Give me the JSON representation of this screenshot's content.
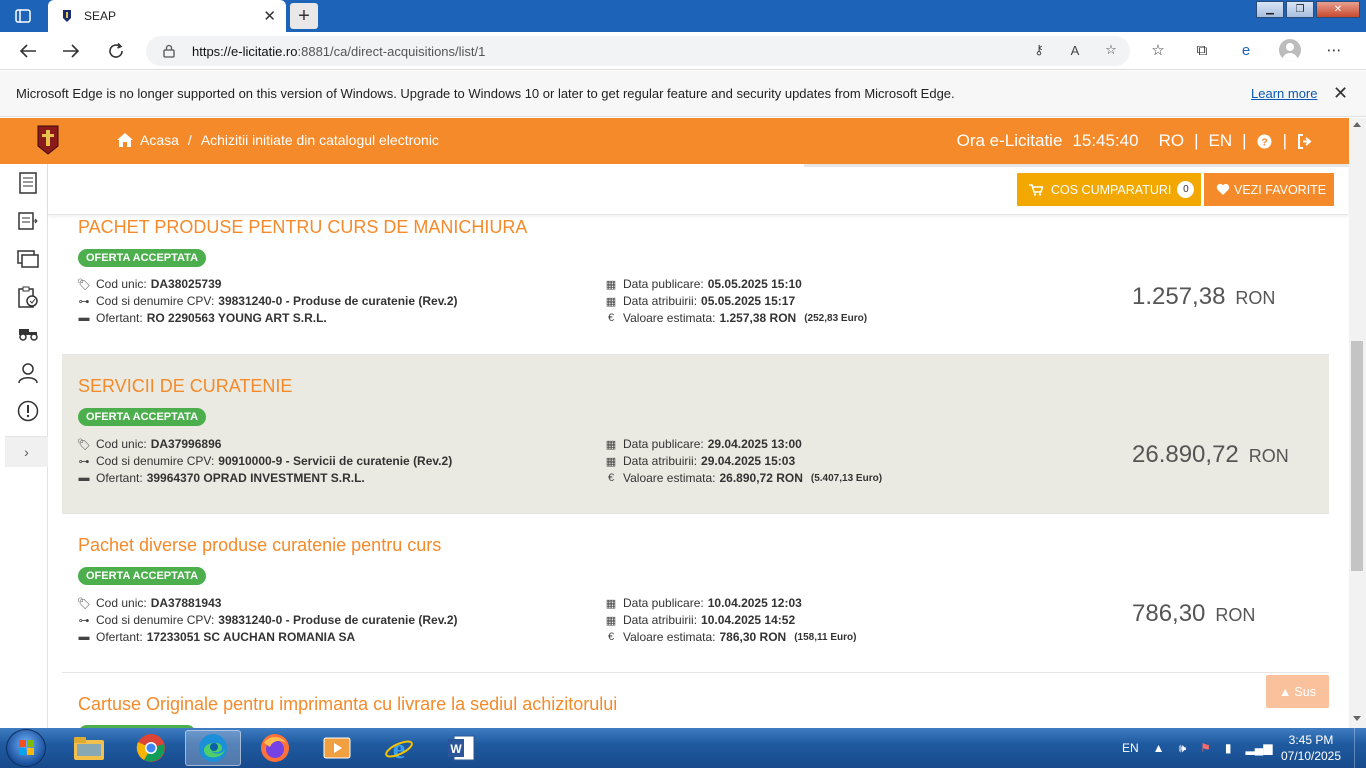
{
  "browser": {
    "tab_title": "SEAP",
    "url_domain": "https://e-licitatie.ro",
    "url_rest": ":8881/ca/direct-acquisitions/list/1",
    "infobar_text": "Microsoft Edge is no longer supported on this version of Windows. Upgrade to Windows 10 or later to get regular feature and security updates from Microsoft Edge.",
    "infobar_link": "Learn more"
  },
  "header": {
    "breadcrumb_home": "Acasa",
    "breadcrumb_sep": "/",
    "breadcrumb_current": "Achizitii initiate din catalogul electronic",
    "time_label": "Ora e-Licitatie",
    "time_value": "15:45:40",
    "lang_ro": "RO",
    "lang_en": "EN",
    "sep": "|"
  },
  "actions": {
    "cart_label": "COS CUMPARATURI",
    "cart_count": "0",
    "favorites_label": "VEZI FAVORITE",
    "scroll_top_label": "Sus"
  },
  "labels": {
    "cod_unic": "Cod unic:",
    "cpv": "Cod si denumire CPV:",
    "ofertant": "Ofertant:",
    "data_publicare": "Data publicare:",
    "data_atribuirii": "Data atribuirii:",
    "valoare_estimata": "Valoare estimata:",
    "euro_symbol": "€"
  },
  "cards": [
    {
      "title": "PACHET PRODUSE PENTRU CURS DE MANICHIURA",
      "status": "OFERTA ACCEPTATA",
      "cod_unic": "DA38025739",
      "cpv": "39831240-0 - Produse de curatenie (Rev.2)",
      "ofertant": "RO 2290563 YOUNG ART S.R.L.",
      "data_publicare": "05.05.2025 15:10",
      "data_atribuirii": "05.05.2025 15:17",
      "valoare": "1.257,38  RON",
      "valoare_euro": "(252,83  Euro)",
      "price": "1.257,38",
      "currency": "RON"
    },
    {
      "title": "SERVICII DE CURATENIE",
      "status": "OFERTA ACCEPTATA",
      "cod_unic": "DA37996896",
      "cpv": "90910000-9 - Servicii de curatenie (Rev.2)",
      "ofertant": "39964370 OPRAD INVESTMENT S.R.L.",
      "data_publicare": "29.04.2025 13:00",
      "data_atribuirii": "29.04.2025 15:03",
      "valoare": "26.890,72  RON",
      "valoare_euro": "(5.407,13  Euro)",
      "price": "26.890,72",
      "currency": "RON"
    },
    {
      "title": "Pachet diverse produse curatenie pentru curs",
      "status": "OFERTA ACCEPTATA",
      "cod_unic": "DA37881943",
      "cpv": "39831240-0 - Produse de curatenie (Rev.2)",
      "ofertant": "17233051 SC AUCHAN ROMANIA SA",
      "data_publicare": "10.04.2025 12:03",
      "data_atribuirii": "10.04.2025 14:52",
      "valoare": "786,30  RON",
      "valoare_euro": "(158,11  Euro)",
      "price": "786,30",
      "currency": "RON"
    },
    {
      "title": "Cartuse Originale pentru imprimanta cu livrare la sediul achizitorului"
    }
  ],
  "taskbar": {
    "lang": "EN",
    "time": "3:45 PM",
    "date": "07/10/2025"
  },
  "colors": {
    "brand_orange": "#f58a2a",
    "cart_yellow": "#f2a800",
    "status_green": "#4cae4c",
    "edge_blue": "#1d63b8"
  }
}
